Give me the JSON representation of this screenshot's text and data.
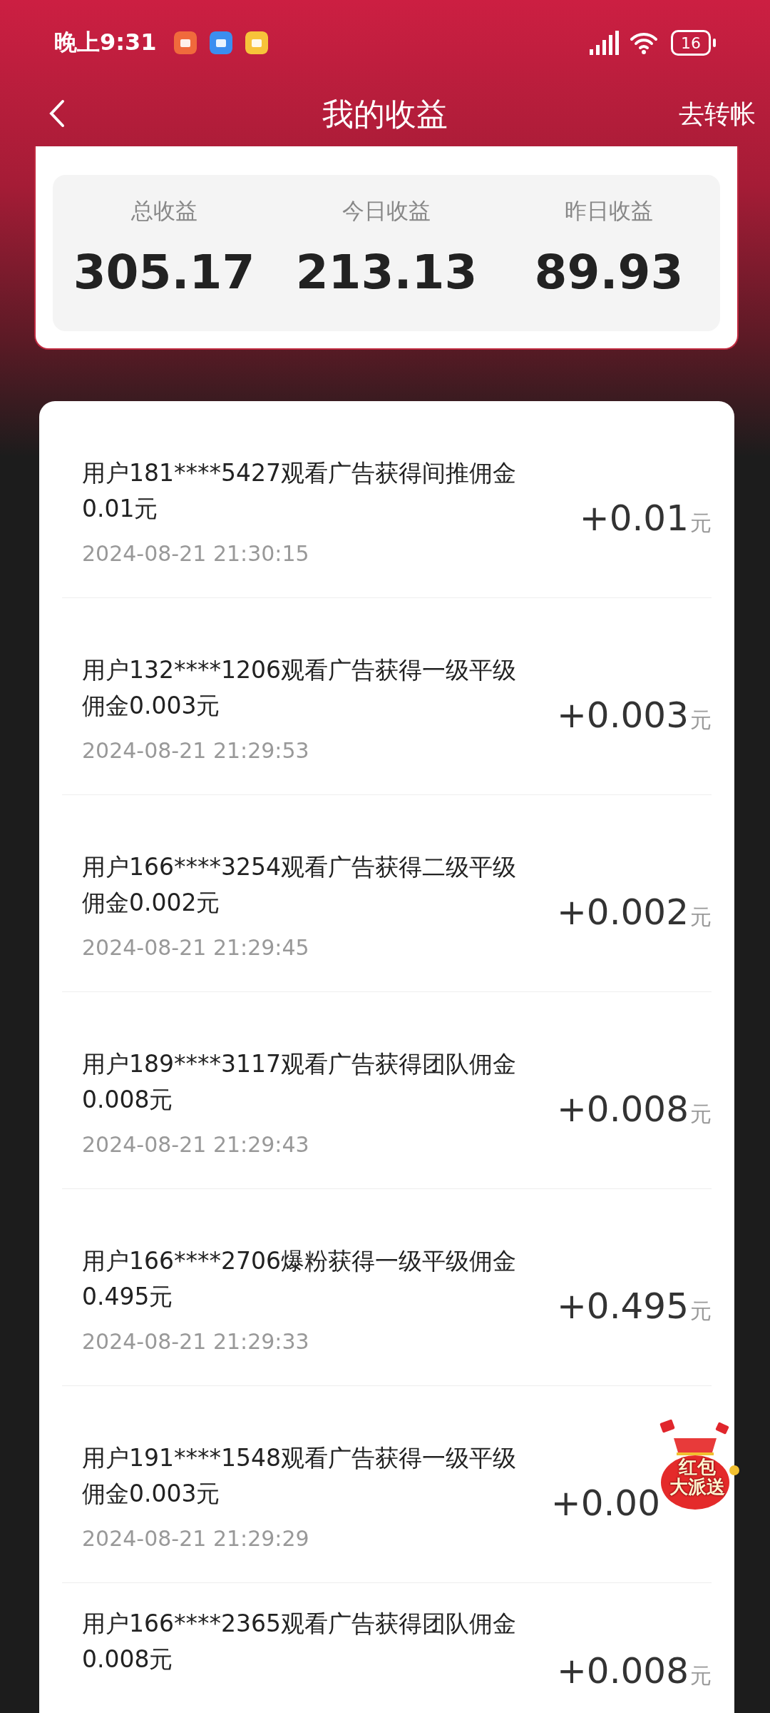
{
  "status_bar": {
    "time": "晚上9:31",
    "battery": "16"
  },
  "nav": {
    "title": "我的收益",
    "action": "去转帐"
  },
  "summary": [
    {
      "label": "总收益",
      "value": "305.17"
    },
    {
      "label": "今日收益",
      "value": "213.13"
    },
    {
      "label": "昨日收益",
      "value": "89.93"
    }
  ],
  "records": [
    {
      "description": "用户181****5427观看广告获得间推佣金0.01元",
      "date": "2024-08-21 21:30:15",
      "amount": "+0.01",
      "unit": "元"
    },
    {
      "description": "用户132****1206观看广告获得一级平级佣金0.003元",
      "date": "2024-08-21 21:29:53",
      "amount": "+0.003",
      "unit": "元"
    },
    {
      "description": "用户166****3254观看广告获得二级平级佣金0.002元",
      "date": "2024-08-21 21:29:45",
      "amount": "+0.002",
      "unit": "元"
    },
    {
      "description": "用户189****3117观看广告获得团队佣金0.008元",
      "date": "2024-08-21 21:29:43",
      "amount": "+0.008",
      "unit": "元"
    },
    {
      "description": "用户166****2706爆粉获得一级平级佣金0.495元",
      "date": "2024-08-21 21:29:33",
      "amount": "+0.495",
      "unit": "元"
    },
    {
      "description": "用户191****1548观看广告获得一级平级佣金0.003元",
      "date": "2024-08-21 21:29:29",
      "amount": "+0.00"
    },
    {
      "description": "用户166****2365观看广告获得团队佣金0.008元",
      "amount": "+0.008",
      "unit": "元"
    }
  ],
  "red_packet": {
    "line_1": "红包",
    "line_2": "大派送"
  }
}
